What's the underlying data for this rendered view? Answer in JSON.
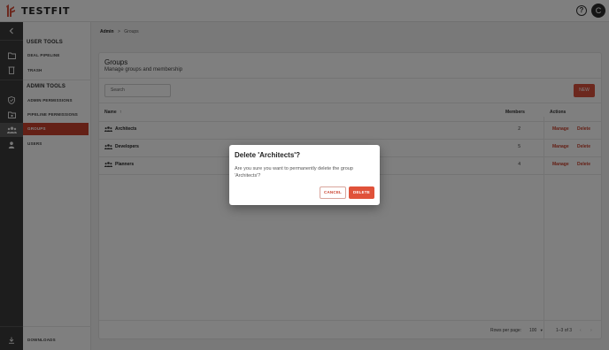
{
  "app": {
    "logo_text": "TESTFIT",
    "avatar_initial": "C",
    "accent": "#c9402c"
  },
  "sidebar": {
    "user_tools_title": "USER TOOLS",
    "admin_tools_title": "ADMIN TOOLS",
    "items": [
      {
        "label": "DEAL PIPELINE"
      },
      {
        "label": "TRASH"
      },
      {
        "label": "ADMIN PERMISSIONS"
      },
      {
        "label": "PIPELINE PERMISSIONS"
      },
      {
        "label": "GROUPS"
      },
      {
        "label": "USERS"
      }
    ],
    "downloads_label": "DOWNLOADS"
  },
  "breadcrumb": {
    "root": "Admin",
    "sep": ">",
    "current": "Groups"
  },
  "card": {
    "title": "Groups",
    "subtitle": "Manage groups and membership",
    "search_placeholder": "Search",
    "new_label": "NEW"
  },
  "table": {
    "headers": {
      "name": "Name",
      "sort": "↑",
      "members": "Members",
      "actions": "Actions"
    },
    "manage_label": "Manage",
    "delete_label": "Delete",
    "rows": [
      {
        "name": "Architects",
        "members": "2"
      },
      {
        "name": "Developers",
        "members": "5"
      },
      {
        "name": "Planners",
        "members": "4"
      }
    ]
  },
  "pagination": {
    "rows_per_page_label": "Rows per page:",
    "rows_per_page": "100",
    "range": "1–3 of 3"
  },
  "dialog": {
    "title": "Delete 'Architects'?",
    "body": "Are you sure you want to permanently delete the group 'Architects'?",
    "cancel_label": "CANCEL",
    "delete_label": "DELETE"
  }
}
